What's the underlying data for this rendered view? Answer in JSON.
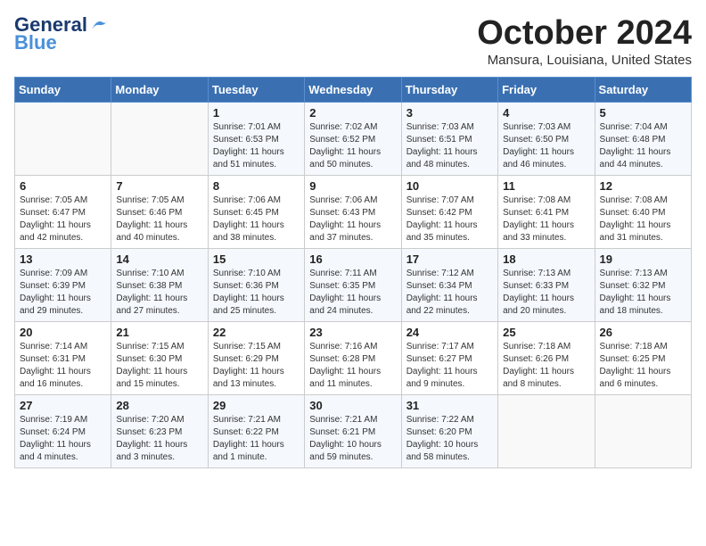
{
  "header": {
    "logo_line1": "General",
    "logo_line2": "Blue",
    "month": "October 2024",
    "location": "Mansura, Louisiana, United States"
  },
  "days_of_week": [
    "Sunday",
    "Monday",
    "Tuesday",
    "Wednesday",
    "Thursday",
    "Friday",
    "Saturday"
  ],
  "weeks": [
    [
      {
        "day": "",
        "sunrise": "",
        "sunset": "",
        "daylight": ""
      },
      {
        "day": "",
        "sunrise": "",
        "sunset": "",
        "daylight": ""
      },
      {
        "day": "1",
        "sunrise": "Sunrise: 7:01 AM",
        "sunset": "Sunset: 6:53 PM",
        "daylight": "Daylight: 11 hours and 51 minutes."
      },
      {
        "day": "2",
        "sunrise": "Sunrise: 7:02 AM",
        "sunset": "Sunset: 6:52 PM",
        "daylight": "Daylight: 11 hours and 50 minutes."
      },
      {
        "day": "3",
        "sunrise": "Sunrise: 7:03 AM",
        "sunset": "Sunset: 6:51 PM",
        "daylight": "Daylight: 11 hours and 48 minutes."
      },
      {
        "day": "4",
        "sunrise": "Sunrise: 7:03 AM",
        "sunset": "Sunset: 6:50 PM",
        "daylight": "Daylight: 11 hours and 46 minutes."
      },
      {
        "day": "5",
        "sunrise": "Sunrise: 7:04 AM",
        "sunset": "Sunset: 6:48 PM",
        "daylight": "Daylight: 11 hours and 44 minutes."
      }
    ],
    [
      {
        "day": "6",
        "sunrise": "Sunrise: 7:05 AM",
        "sunset": "Sunset: 6:47 PM",
        "daylight": "Daylight: 11 hours and 42 minutes."
      },
      {
        "day": "7",
        "sunrise": "Sunrise: 7:05 AM",
        "sunset": "Sunset: 6:46 PM",
        "daylight": "Daylight: 11 hours and 40 minutes."
      },
      {
        "day": "8",
        "sunrise": "Sunrise: 7:06 AM",
        "sunset": "Sunset: 6:45 PM",
        "daylight": "Daylight: 11 hours and 38 minutes."
      },
      {
        "day": "9",
        "sunrise": "Sunrise: 7:06 AM",
        "sunset": "Sunset: 6:43 PM",
        "daylight": "Daylight: 11 hours and 37 minutes."
      },
      {
        "day": "10",
        "sunrise": "Sunrise: 7:07 AM",
        "sunset": "Sunset: 6:42 PM",
        "daylight": "Daylight: 11 hours and 35 minutes."
      },
      {
        "day": "11",
        "sunrise": "Sunrise: 7:08 AM",
        "sunset": "Sunset: 6:41 PM",
        "daylight": "Daylight: 11 hours and 33 minutes."
      },
      {
        "day": "12",
        "sunrise": "Sunrise: 7:08 AM",
        "sunset": "Sunset: 6:40 PM",
        "daylight": "Daylight: 11 hours and 31 minutes."
      }
    ],
    [
      {
        "day": "13",
        "sunrise": "Sunrise: 7:09 AM",
        "sunset": "Sunset: 6:39 PM",
        "daylight": "Daylight: 11 hours and 29 minutes."
      },
      {
        "day": "14",
        "sunrise": "Sunrise: 7:10 AM",
        "sunset": "Sunset: 6:38 PM",
        "daylight": "Daylight: 11 hours and 27 minutes."
      },
      {
        "day": "15",
        "sunrise": "Sunrise: 7:10 AM",
        "sunset": "Sunset: 6:36 PM",
        "daylight": "Daylight: 11 hours and 25 minutes."
      },
      {
        "day": "16",
        "sunrise": "Sunrise: 7:11 AM",
        "sunset": "Sunset: 6:35 PM",
        "daylight": "Daylight: 11 hours and 24 minutes."
      },
      {
        "day": "17",
        "sunrise": "Sunrise: 7:12 AM",
        "sunset": "Sunset: 6:34 PM",
        "daylight": "Daylight: 11 hours and 22 minutes."
      },
      {
        "day": "18",
        "sunrise": "Sunrise: 7:13 AM",
        "sunset": "Sunset: 6:33 PM",
        "daylight": "Daylight: 11 hours and 20 minutes."
      },
      {
        "day": "19",
        "sunrise": "Sunrise: 7:13 AM",
        "sunset": "Sunset: 6:32 PM",
        "daylight": "Daylight: 11 hours and 18 minutes."
      }
    ],
    [
      {
        "day": "20",
        "sunrise": "Sunrise: 7:14 AM",
        "sunset": "Sunset: 6:31 PM",
        "daylight": "Daylight: 11 hours and 16 minutes."
      },
      {
        "day": "21",
        "sunrise": "Sunrise: 7:15 AM",
        "sunset": "Sunset: 6:30 PM",
        "daylight": "Daylight: 11 hours and 15 minutes."
      },
      {
        "day": "22",
        "sunrise": "Sunrise: 7:15 AM",
        "sunset": "Sunset: 6:29 PM",
        "daylight": "Daylight: 11 hours and 13 minutes."
      },
      {
        "day": "23",
        "sunrise": "Sunrise: 7:16 AM",
        "sunset": "Sunset: 6:28 PM",
        "daylight": "Daylight: 11 hours and 11 minutes."
      },
      {
        "day": "24",
        "sunrise": "Sunrise: 7:17 AM",
        "sunset": "Sunset: 6:27 PM",
        "daylight": "Daylight: 11 hours and 9 minutes."
      },
      {
        "day": "25",
        "sunrise": "Sunrise: 7:18 AM",
        "sunset": "Sunset: 6:26 PM",
        "daylight": "Daylight: 11 hours and 8 minutes."
      },
      {
        "day": "26",
        "sunrise": "Sunrise: 7:18 AM",
        "sunset": "Sunset: 6:25 PM",
        "daylight": "Daylight: 11 hours and 6 minutes."
      }
    ],
    [
      {
        "day": "27",
        "sunrise": "Sunrise: 7:19 AM",
        "sunset": "Sunset: 6:24 PM",
        "daylight": "Daylight: 11 hours and 4 minutes."
      },
      {
        "day": "28",
        "sunrise": "Sunrise: 7:20 AM",
        "sunset": "Sunset: 6:23 PM",
        "daylight": "Daylight: 11 hours and 3 minutes."
      },
      {
        "day": "29",
        "sunrise": "Sunrise: 7:21 AM",
        "sunset": "Sunset: 6:22 PM",
        "daylight": "Daylight: 11 hours and 1 minute."
      },
      {
        "day": "30",
        "sunrise": "Sunrise: 7:21 AM",
        "sunset": "Sunset: 6:21 PM",
        "daylight": "Daylight: 10 hours and 59 minutes."
      },
      {
        "day": "31",
        "sunrise": "Sunrise: 7:22 AM",
        "sunset": "Sunset: 6:20 PM",
        "daylight": "Daylight: 10 hours and 58 minutes."
      },
      {
        "day": "",
        "sunrise": "",
        "sunset": "",
        "daylight": ""
      },
      {
        "day": "",
        "sunrise": "",
        "sunset": "",
        "daylight": ""
      }
    ]
  ]
}
